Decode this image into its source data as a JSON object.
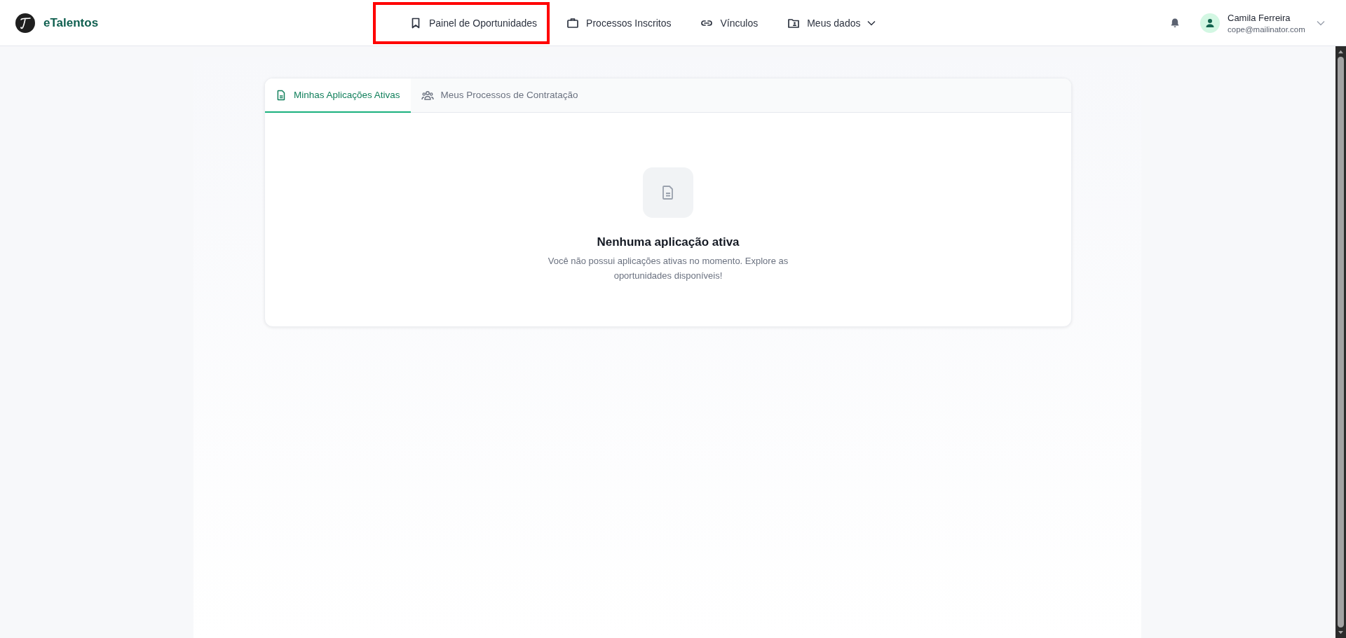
{
  "header": {
    "brand": "eTalentos",
    "nav": [
      {
        "label": "Painel de Oportunidades",
        "kind": "link",
        "highlighted": true
      },
      {
        "label": "Processos Inscritos",
        "kind": "link",
        "highlighted": false
      },
      {
        "label": "Vínculos",
        "kind": "link",
        "highlighted": false
      },
      {
        "label": "Meus dados",
        "kind": "dropdown",
        "highlighted": false
      }
    ],
    "user": {
      "name": "Camila Ferreira",
      "email": "cope@mailinator.com"
    }
  },
  "tabs": [
    {
      "label": "Minhas Aplicações Ativas",
      "selected": true
    },
    {
      "label": "Meus Processos de Contratação",
      "selected": false
    }
  ],
  "empty_state": {
    "title": "Nenhuma aplicação ativa",
    "message": "Você não possui aplicações ativas no momento. Explore as oportunidades disponíveis!"
  }
}
